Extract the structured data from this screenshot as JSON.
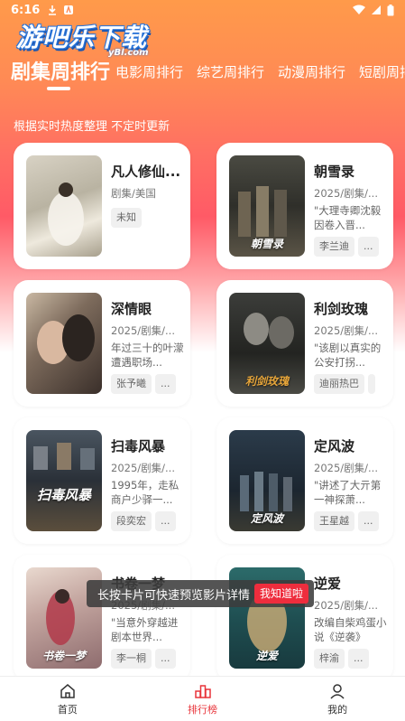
{
  "status": {
    "time": "6:16"
  },
  "logo": {
    "text": "游吧乐下载",
    "sub": "yBl.com"
  },
  "tabs": [
    {
      "label": "剧集周排行",
      "active": true
    },
    {
      "label": "电影周排行"
    },
    {
      "label": "综艺周排行"
    },
    {
      "label": "动漫周排行"
    },
    {
      "label": "短剧周排"
    }
  ],
  "subtitle": "根据实时热度整理 不定时更新",
  "cards": [
    {
      "title": "凡人修仙...",
      "meta": "剧集/美国",
      "desc": "",
      "tags": [
        "未知"
      ],
      "poster_text": ""
    },
    {
      "title": "朝雪录",
      "meta": "2025/剧集/...",
      "desc": "\"大理寺卿沈毅因卷入晋...",
      "tags": [
        "李兰迪",
        "..."
      ],
      "poster_text": "朝雪录"
    },
    {
      "title": "深情眼",
      "meta": "2025/剧集/...",
      "desc": "年过三十的叶濛遭遇职场...",
      "tags": [
        "张予曦",
        "..."
      ],
      "poster_text": ""
    },
    {
      "title": "利剑玫瑰",
      "meta": "2025/剧集/...",
      "desc": "\"该剧以真实的公安打拐...",
      "tags": [
        "迪丽热巴",
        ""
      ],
      "poster_text": "利剑玫瑰"
    },
    {
      "title": "扫毒风暴",
      "meta": "2025/剧集/...",
      "desc": "1995年，走私商户少驿一...",
      "tags": [
        "段奕宏",
        "..."
      ],
      "poster_text": "扫毒风暴"
    },
    {
      "title": "定风波",
      "meta": "2025/剧集/...",
      "desc": "\"讲述了大亓第一神探萧...",
      "tags": [
        "王星越",
        "..."
      ],
      "poster_text": "定风波"
    },
    {
      "title": "书卷一梦",
      "meta": "2025/剧集/...",
      "desc": "\"当意外穿越进剧本世界...",
      "tags": [
        "李一桐",
        "..."
      ],
      "poster_text": "书卷一梦"
    },
    {
      "title": "逆爱",
      "meta": "2025/剧集/...",
      "desc": "改编自柴鸡蛋小说《逆袭》",
      "tags": [
        "梓渝",
        "..."
      ],
      "poster_text": "逆爱"
    }
  ],
  "toast": {
    "message": "长按卡片可快速预览影片详情",
    "button": "我知道啦"
  },
  "nav": [
    {
      "label": "首页",
      "icon": "home-icon"
    },
    {
      "label": "排行榜",
      "icon": "ranking-icon",
      "active": true
    },
    {
      "label": "我的",
      "icon": "profile-icon"
    }
  ],
  "colors": {
    "accent": "#e8343a",
    "header_top": "#ff9a4a",
    "header_mid": "#ff5a66"
  }
}
